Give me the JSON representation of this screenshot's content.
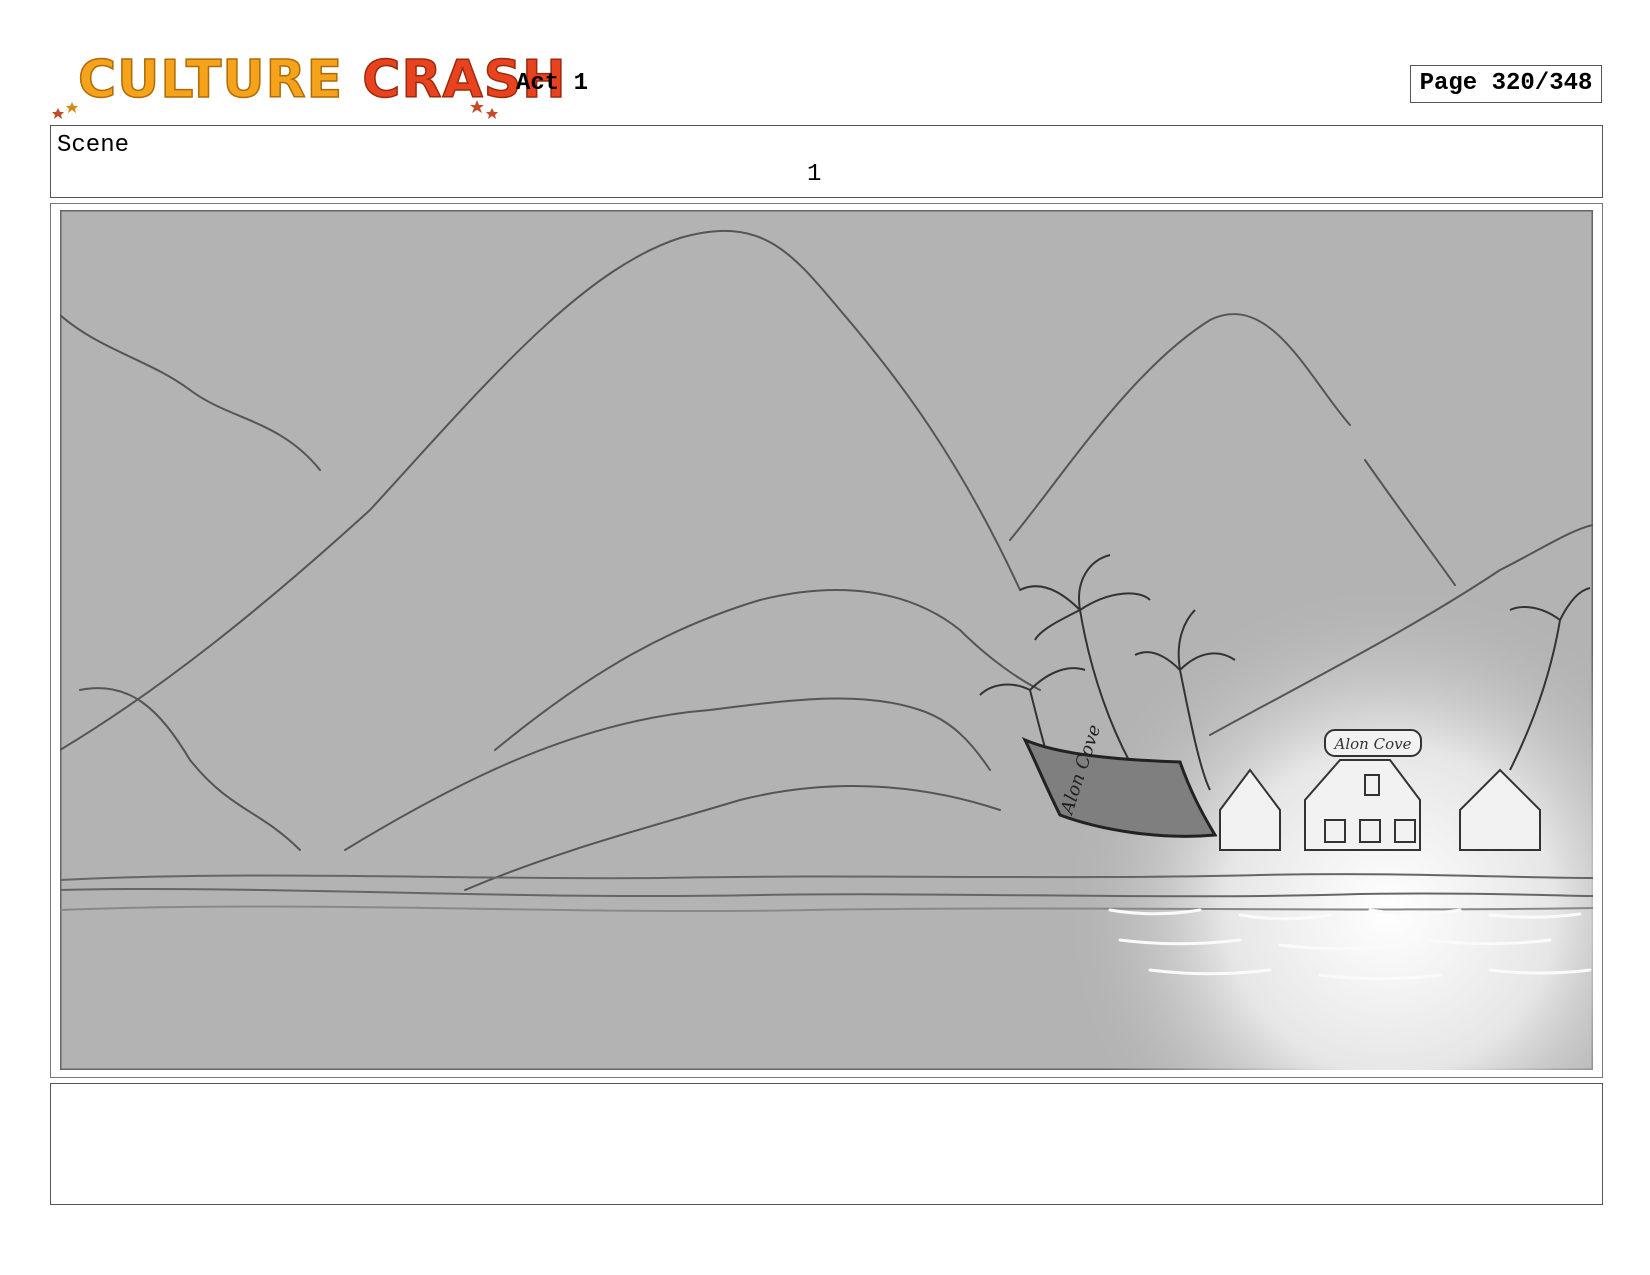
{
  "header": {
    "logo": {
      "word1": "CULTURE",
      "word2": "CRASH"
    },
    "act": "Act 1",
    "page": "Page 320/348"
  },
  "scene": {
    "label": "Scene",
    "number": "1"
  },
  "panel": {
    "signs": {
      "building": "Alon Cove",
      "boat": "Alon Cove"
    },
    "background_color": "#b3b3b3"
  },
  "notes": {
    "text": ""
  }
}
